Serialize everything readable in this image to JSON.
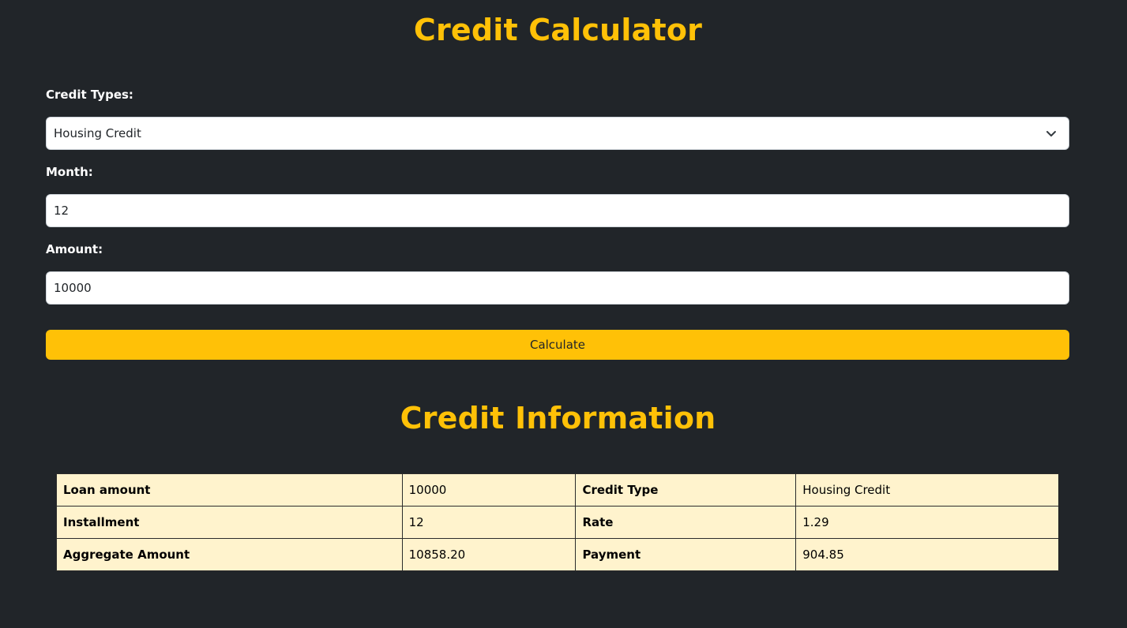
{
  "title": "Credit Calculator",
  "form": {
    "credit_types_label": "Credit Types:",
    "credit_type_selected": "Housing Credit",
    "month_label": "Month:",
    "month_value": "12",
    "amount_label": "Amount:",
    "amount_value": "10000",
    "calculate_label": "Calculate"
  },
  "info": {
    "title": "Credit Information",
    "rows": [
      [
        {
          "label": "Loan amount",
          "value": "10000"
        },
        {
          "label": "Credit Type",
          "value": "Housing Credit"
        }
      ],
      [
        {
          "label": "Installment",
          "value": "12"
        },
        {
          "label": "Rate",
          "value": "1.29"
        }
      ],
      [
        {
          "label": "Aggregate Amount",
          "value": "10858.20"
        },
        {
          "label": "Payment",
          "value": "904.85"
        }
      ]
    ]
  },
  "colors": {
    "background": "#212529",
    "accent": "#ffc107",
    "table_background": "#fff3cd"
  },
  "icons": {
    "select_chevron": "chevron-down-icon"
  }
}
